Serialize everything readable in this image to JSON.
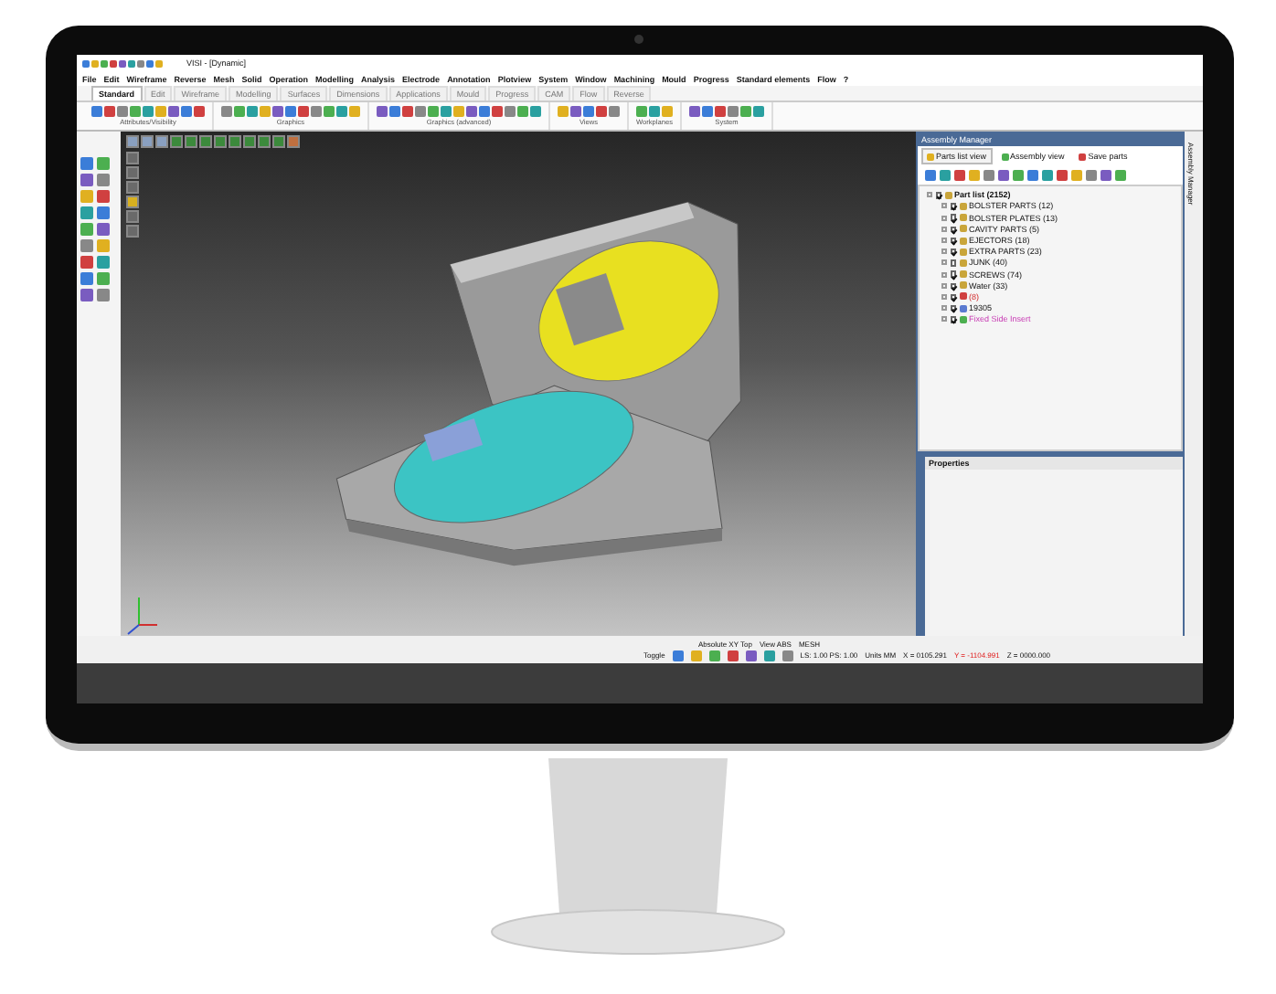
{
  "window": {
    "title": "VISI - [Dynamic]"
  },
  "menu": [
    "File",
    "Edit",
    "Wireframe",
    "Reverse",
    "Mesh",
    "Solid",
    "Operation",
    "Modelling",
    "Analysis",
    "Electrode",
    "Annotation",
    "Plotview",
    "System",
    "Window",
    "Machining",
    "Mould",
    "Progress",
    "Standard elements",
    "Flow",
    "?"
  ],
  "tabs": [
    {
      "label": "Standard",
      "selected": true
    },
    {
      "label": "Edit",
      "selected": false
    },
    {
      "label": "Wireframe",
      "selected": false
    },
    {
      "label": "Modelling",
      "selected": false
    },
    {
      "label": "Surfaces",
      "selected": false
    },
    {
      "label": "Dimensions",
      "selected": false
    },
    {
      "label": "Applications",
      "selected": false
    },
    {
      "label": "Mould",
      "selected": false
    },
    {
      "label": "Progress",
      "selected": false
    },
    {
      "label": "CAM",
      "selected": false
    },
    {
      "label": "Flow",
      "selected": false
    },
    {
      "label": "Reverse",
      "selected": false
    }
  ],
  "toolbar_groups": [
    {
      "label": "Attributes/Visibility"
    },
    {
      "label": "Graphics"
    },
    {
      "label": "Graphics (advanced)"
    },
    {
      "label": "Views"
    },
    {
      "label": "Workplanes"
    },
    {
      "label": "System"
    }
  ],
  "assembly_manager": {
    "title": "Assembly Manager",
    "tabs": [
      {
        "label": "Parts list view",
        "selected": true
      },
      {
        "label": "Assembly view",
        "selected": false
      },
      {
        "label": "Save parts",
        "selected": false
      }
    ],
    "tree": {
      "label": "Part list (2152)",
      "checked": true,
      "children": [
        {
          "label": "BOLSTER PARTS (12)",
          "checked": true,
          "kind": "group"
        },
        {
          "label": "BOLSTER PLATES (13)",
          "checked": true,
          "kind": "group"
        },
        {
          "label": "CAVITY PARTS (5)",
          "checked": true,
          "kind": "group"
        },
        {
          "label": "EJECTORS (18)",
          "checked": true,
          "kind": "group"
        },
        {
          "label": "EXTRA PARTS (23)",
          "checked": true,
          "kind": "group"
        },
        {
          "label": "JUNK (40)",
          "checked": false,
          "kind": "group"
        },
        {
          "label": "SCREWS (74)",
          "checked": true,
          "kind": "group"
        },
        {
          "label": "Water (33)",
          "checked": true,
          "kind": "group"
        },
        {
          "label": "(8)",
          "checked": true,
          "kind": "error"
        },
        {
          "label": "19305",
          "checked": true,
          "kind": "part"
        },
        {
          "label": "Fixed Side Insert",
          "checked": true,
          "kind": "insert"
        }
      ]
    },
    "properties_title": "Properties"
  },
  "side_tab": "Assembly Manager",
  "status_bar": {
    "top": [
      "Absolute XY Top",
      "View ABS",
      "MESH"
    ],
    "toggle": "Toggle",
    "scale": "LS: 1.00 PS: 1.00",
    "units": "Units MM",
    "coordinates": [
      {
        "text": "X = 0105.291",
        "highlighted": false
      },
      {
        "text": "Y = -1104.991",
        "highlighted": true
      },
      {
        "text": "Z = 0000.000",
        "highlighted": false
      }
    ]
  }
}
